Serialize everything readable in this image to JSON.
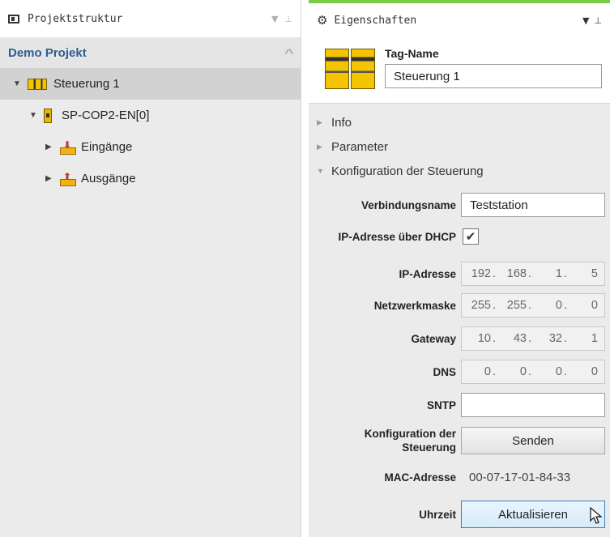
{
  "left_panel": {
    "title": "Projektstruktur",
    "pin_label": "▾ ⊥",
    "project_name": "Demo Projekt",
    "tree": [
      {
        "label": "Steuerung 1",
        "level": 0,
        "expanded": true,
        "selected": true,
        "icon": "controller-icon"
      },
      {
        "label": "SP-COP2-EN[0]",
        "level": 1,
        "expanded": true,
        "selected": false,
        "icon": "module-icon"
      },
      {
        "label": "Eingänge",
        "level": 2,
        "expanded": false,
        "selected": false,
        "icon": "inputs-icon"
      },
      {
        "label": "Ausgänge",
        "level": 2,
        "expanded": false,
        "selected": false,
        "icon": "outputs-icon"
      }
    ]
  },
  "right_panel": {
    "title": "Eigenschaften",
    "tag_label": "Tag-Name",
    "tag_value": "Steuerung 1",
    "sections": [
      {
        "label": "Info",
        "expanded": false
      },
      {
        "label": "Parameter",
        "expanded": false
      },
      {
        "label": "Konfiguration der Steuerung",
        "expanded": true
      }
    ],
    "config": {
      "connection_name_label": "Verbindungsname",
      "connection_name_value": "Teststation",
      "dhcp_label": "IP-Adresse über DHCP",
      "dhcp_checked": true,
      "ip_label": "IP-Adresse",
      "ip_octets": [
        "192",
        "168",
        "1",
        "5"
      ],
      "netmask_label": "Netzwerkmaske",
      "netmask_octets": [
        "255",
        "255",
        "0",
        "0"
      ],
      "gateway_label": "Gateway",
      "gateway_octets": [
        "10",
        "43",
        "32",
        "1"
      ],
      "dns_label": "DNS",
      "dns_octets": [
        "0",
        "0",
        "0",
        "0"
      ],
      "sntp_label": "SNTP",
      "sntp_value": "",
      "send_config_label": "Konfiguration der Steuerung",
      "send_button": "Senden",
      "mac_label": "MAC-Adresse",
      "mac_value": "00-07-17-01-84-33",
      "time_label": "Uhrzeit",
      "update_button": "Aktualisieren"
    }
  },
  "colors": {
    "accent_green": "#7cc943",
    "project_blue": "#2d5d8e",
    "panel_bg": "#ebebeb"
  }
}
